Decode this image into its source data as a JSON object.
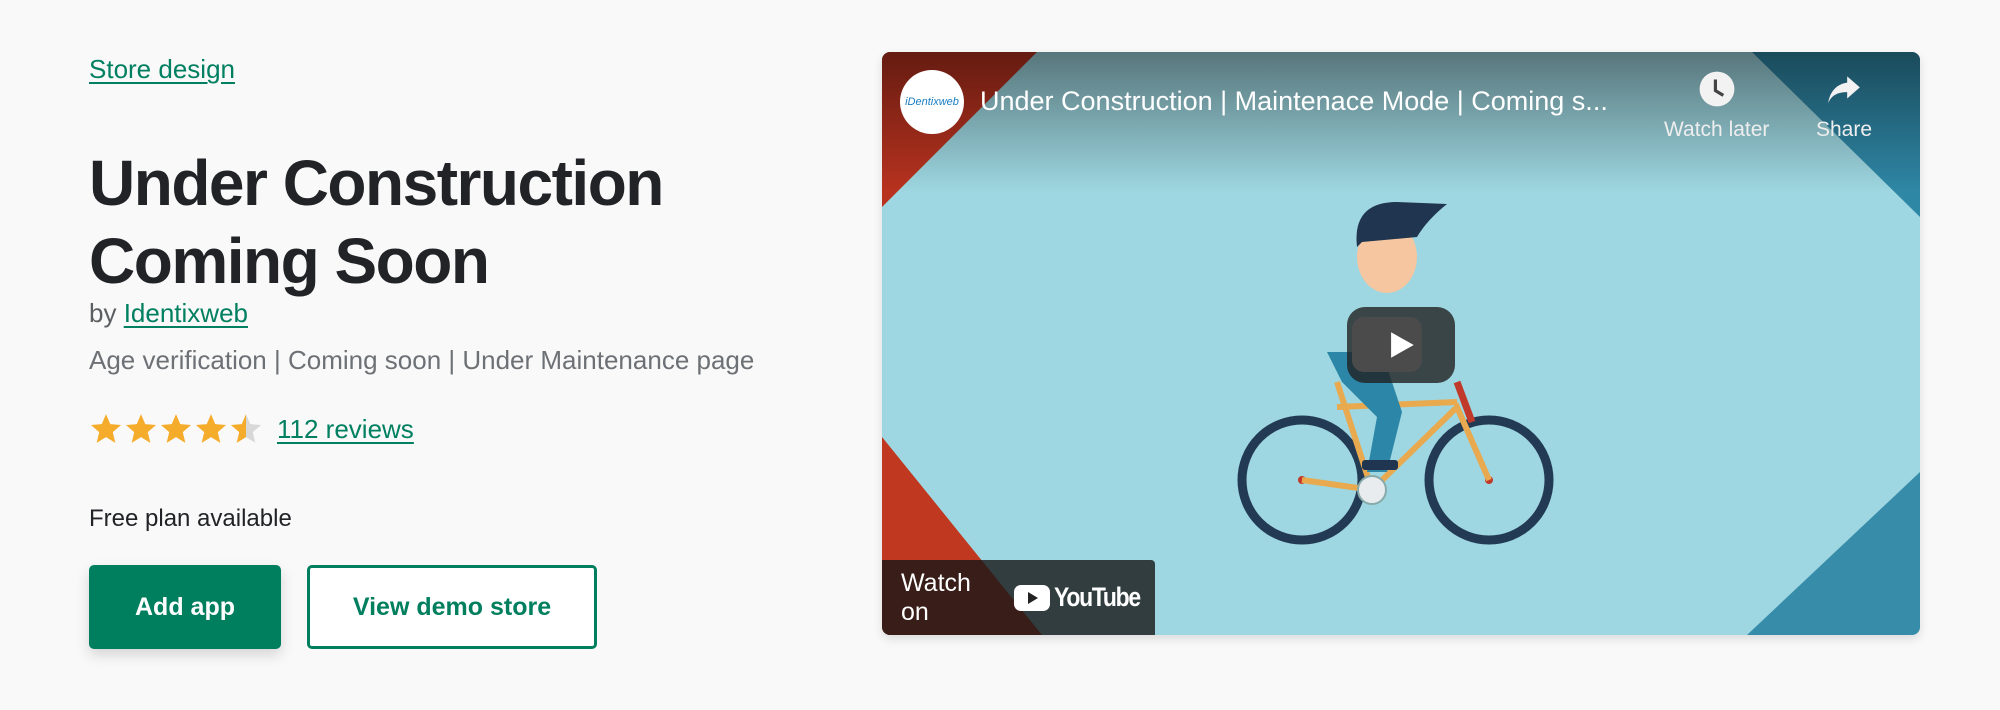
{
  "category": {
    "label": "Store design"
  },
  "app": {
    "title": "Under Construction Coming Soon",
    "by_prefix": "by",
    "developer": "Identixweb",
    "tagline": "Age verification | Coming soon | Under Maintenance page",
    "rating": 4.5,
    "rating_max": 5,
    "reviews_label": "112 reviews",
    "pricing": "Free plan available"
  },
  "actions": {
    "primary_label": "Add app",
    "secondary_label": "View demo store"
  },
  "video": {
    "title": "Under Construction | Maintenace Mode | Coming s...",
    "channel_logo_text": "iDentixweb",
    "watch_later_label": "Watch later",
    "share_label": "Share",
    "watch_on_label": "Watch on",
    "youtube_label": "YouTube"
  },
  "colors": {
    "brand": "#008060",
    "star_filled": "#f5ac2a",
    "star_empty": "#d8d8d8",
    "background": "#f9f9f9"
  }
}
